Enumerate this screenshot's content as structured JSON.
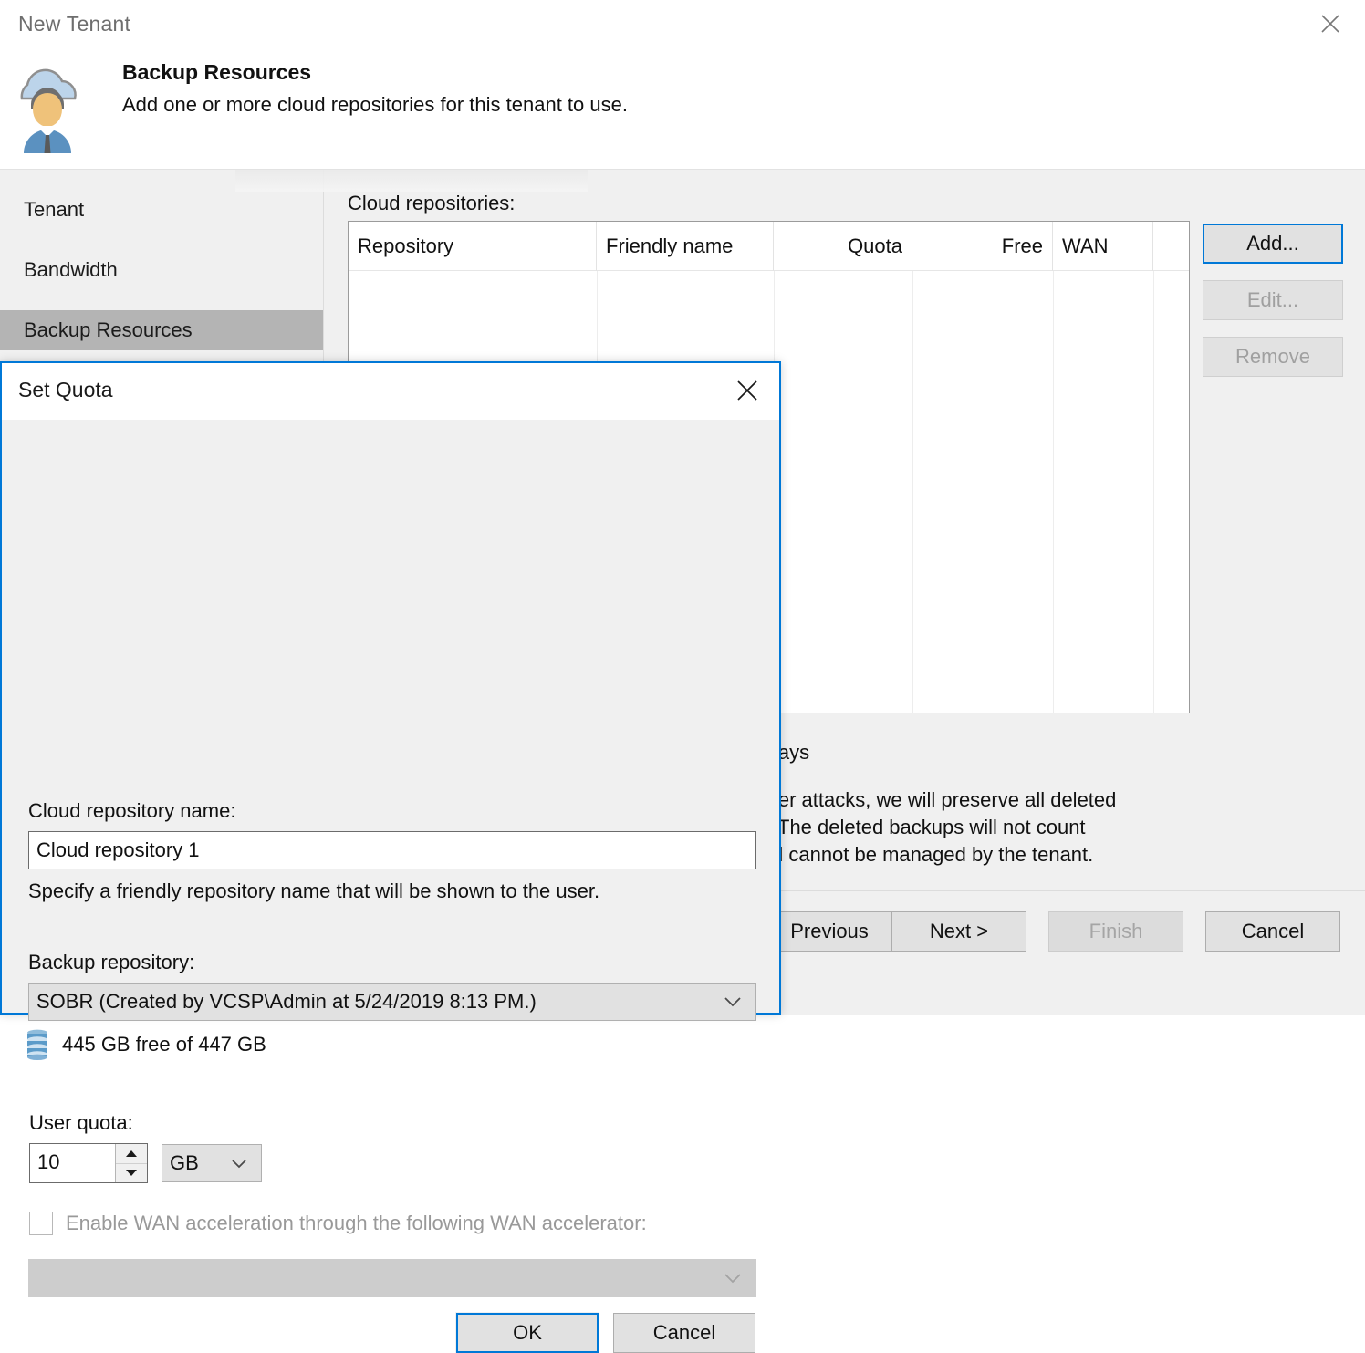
{
  "wizard": {
    "window_title": "New Tenant",
    "close_icon": "close-icon",
    "header": {
      "icon": "cloud-user-icon",
      "title": "Backup Resources",
      "subtitle": "Add one or more cloud repositories for this tenant to use."
    },
    "sidebar": {
      "items": [
        {
          "label": "Tenant",
          "selected": false
        },
        {
          "label": "Bandwidth",
          "selected": false
        },
        {
          "label": "Backup Resources",
          "selected": true
        }
      ]
    },
    "main": {
      "grid_label": "Cloud repositories:",
      "columns": [
        {
          "label": "Repository",
          "align": "left"
        },
        {
          "label": "Friendly name",
          "align": "left"
        },
        {
          "label": "Quota",
          "align": "right"
        },
        {
          "label": "Free",
          "align": "right"
        },
        {
          "label": "WAN",
          "align": "left"
        }
      ],
      "rows": [],
      "side_buttons": [
        {
          "label": "Add...",
          "state": "default"
        },
        {
          "label": "Edit...",
          "state": "disabled"
        },
        {
          "label": "Remove",
          "state": "disabled"
        }
      ],
      "occluded_text": {
        "line1": "lays",
        "line2": "ler attacks, we will preserve all deleted",
        "line3": "The deleted backups will not count",
        "line4": "d cannot be managed by the tenant."
      }
    },
    "footer": {
      "buttons": [
        {
          "label": "Previous",
          "state": "normal"
        },
        {
          "label": "Next >",
          "state": "normal"
        },
        {
          "label": "Finish",
          "state": "disabled"
        },
        {
          "label": "Cancel",
          "state": "normal"
        }
      ]
    }
  },
  "modal": {
    "title": "Set Quota",
    "close_icon": "close-icon",
    "repo_name": {
      "label": "Cloud repository name:",
      "value": "Cloud repository 1",
      "placeholder": "Cloud repository 1",
      "hint": "Specify a friendly repository name that will be shown to the user."
    },
    "backup_repository": {
      "label": "Backup repository:",
      "value": "SOBR (Created by VCSP\\Admin at 5/24/2019 8:13 PM.)",
      "free_space": "445 GB free of 447 GB",
      "free_space_icon": "database-icon"
    },
    "user_quota": {
      "label": "User quota:",
      "value": "10",
      "unit": "GB",
      "spin_up_icon": "chevron-up-icon",
      "spin_down_icon": "chevron-down-icon"
    },
    "wan": {
      "checkbox_label": "Enable WAN acceleration through the following WAN accelerator:",
      "checked": false,
      "enabled": false,
      "accelerator_value": ""
    },
    "buttons": [
      {
        "label": "OK",
        "state": "default"
      },
      {
        "label": "Cancel",
        "state": "normal"
      }
    ]
  },
  "colors": {
    "accent": "#0078d7",
    "window_bg": "#f0f0f0",
    "selection_bg": "#b4b4b4",
    "disabled_text": "#a0a0a0"
  }
}
